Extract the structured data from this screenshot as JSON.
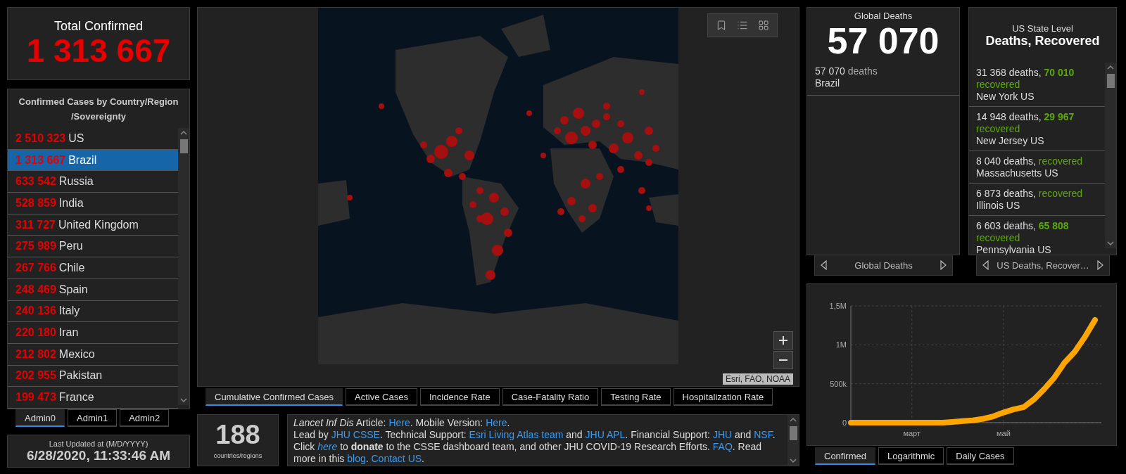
{
  "total_confirmed": {
    "title": "Total Confirmed",
    "value": "1 313 667"
  },
  "country_list": {
    "title_lines": [
      "Confirmed Cases by Country/Region",
      "/Sovereignty"
    ],
    "rows": [
      {
        "count": "2 510 323",
        "name": "US",
        "selected": false
      },
      {
        "count": "1 313 667",
        "name": "Brazil",
        "selected": true
      },
      {
        "count": "633 542",
        "name": "Russia",
        "selected": false
      },
      {
        "count": "528 859",
        "name": "India",
        "selected": false
      },
      {
        "count": "311 727",
        "name": "United Kingdom",
        "selected": false
      },
      {
        "count": "275 989",
        "name": "Peru",
        "selected": false
      },
      {
        "count": "267 766",
        "name": "Chile",
        "selected": false
      },
      {
        "count": "248 469",
        "name": "Spain",
        "selected": false
      },
      {
        "count": "240 136",
        "name": "Italy",
        "selected": false
      },
      {
        "count": "220 180",
        "name": "Iran",
        "selected": false
      },
      {
        "count": "212 802",
        "name": "Mexico",
        "selected": false
      },
      {
        "count": "202 955",
        "name": "Pakistan",
        "selected": false
      },
      {
        "count": "199 473",
        "name": "France",
        "selected": false
      }
    ]
  },
  "admin_tabs": [
    {
      "label": "Admin0",
      "selected": true
    },
    {
      "label": "Admin1",
      "selected": false
    },
    {
      "label": "Admin2",
      "selected": false
    }
  ],
  "last_updated": {
    "label": "Last Updated at (M/D/YYYY)",
    "value": "6/28/2020, 11:33:46 AM"
  },
  "map": {
    "attribution": "Esri, FAO, NOAA"
  },
  "map_tabs": [
    {
      "label": "Cumulative Confirmed Cases",
      "selected": true
    },
    {
      "label": "Active Cases",
      "selected": false
    },
    {
      "label": "Incidence Rate",
      "selected": false
    },
    {
      "label": "Case-Fatality Ratio",
      "selected": false
    },
    {
      "label": "Testing Rate",
      "selected": false
    },
    {
      "label": "Hospitalization Rate",
      "selected": false
    }
  ],
  "country_count": {
    "value": "188",
    "label": "countries/regions"
  },
  "info_paragraphs": [
    [
      {
        "kind": "italic",
        "text": "Lancet Inf Dis"
      },
      {
        "kind": "text",
        "text": " Article: "
      },
      {
        "kind": "link",
        "text": "Here"
      },
      {
        "kind": "text",
        "text": ". Mobile Version: "
      },
      {
        "kind": "link",
        "text": "Here"
      },
      {
        "kind": "text",
        "text": "."
      }
    ],
    [
      {
        "kind": "text",
        "text": "Lead by "
      },
      {
        "kind": "link",
        "text": "JHU CSSE"
      },
      {
        "kind": "text",
        "text": ". Technical Support: "
      },
      {
        "kind": "link",
        "text": "Esri Living Atlas team"
      },
      {
        "kind": "text",
        "text": " and "
      },
      {
        "kind": "link",
        "text": "JHU APL"
      },
      {
        "kind": "text",
        "text": ". Financial Support: "
      },
      {
        "kind": "link",
        "text": "JHU"
      },
      {
        "kind": "text",
        "text": " and "
      },
      {
        "kind": "link",
        "text": "NSF"
      },
      {
        "kind": "text",
        "text": ". Click "
      },
      {
        "kind": "italic-link",
        "text": "here"
      },
      {
        "kind": "text",
        "text": " to "
      },
      {
        "kind": "bold",
        "text": "donate"
      },
      {
        "kind": "text",
        "text": " to the CSSE dashboard team, and other JHU COVID-19 Research Efforts. "
      },
      {
        "kind": "link",
        "text": "FAQ"
      },
      {
        "kind": "text",
        "text": ". Read more in this "
      },
      {
        "kind": "link",
        "text": "blog"
      },
      {
        "kind": "text",
        "text": ". "
      },
      {
        "kind": "link",
        "text": "Contact US"
      },
      {
        "kind": "text",
        "text": "."
      }
    ]
  ],
  "global_deaths": {
    "title": "Global Deaths",
    "value": "57 070",
    "items": [
      {
        "count": "57 070",
        "unit": "deaths",
        "place": "Brazil"
      }
    ],
    "nav_label": "Global Deaths"
  },
  "us_state_level": {
    "subtitle": "US State Level",
    "title": "Deaths, Recovered",
    "rows": [
      {
        "deaths": "31 368 deaths,",
        "recovered_count": "70 010",
        "recovered_label": "recovered",
        "place": "New York US"
      },
      {
        "deaths": "14 948 deaths,",
        "recovered_count": "29 967",
        "recovered_label": "recovered",
        "place": "New Jersey US"
      },
      {
        "deaths": "8 040 deaths,",
        "recovered_label": "recovered",
        "place": "Massachusetts US"
      },
      {
        "deaths": "6 873 deaths,",
        "recovered_label": "recovered",
        "place": "Illinois US"
      },
      {
        "deaths": "6 603 deaths,",
        "recovered_count": "65 808",
        "recovered_label": "recovered",
        "place": "Pennsylvania US"
      }
    ],
    "nav_label": "US Deaths, Recover…"
  },
  "chart": {
    "chart_data": {
      "type": "line",
      "categories": [
        null,
        null,
        null,
        null,
        null,
        null,
        "март",
        null,
        null,
        null,
        null,
        null,
        null,
        null,
        null,
        "май",
        null,
        null,
        null,
        null,
        null,
        null,
        null,
        null,
        null
      ],
      "series": [
        {
          "color": "#ffa500",
          "values": [
            0,
            0,
            0,
            0,
            0,
            0,
            0,
            0,
            0,
            0,
            10000,
            20000,
            30000,
            50000,
            80000,
            130000,
            170000,
            200000,
            300000,
            430000,
            580000,
            770000,
            910000,
            1100000,
            1320000
          ]
        }
      ],
      "grid": true,
      "ylim": [
        0,
        1500000
      ],
      "yticks": [
        {
          "value": 0,
          "label": "0"
        },
        {
          "value": 500000,
          "label": "500k"
        },
        {
          "value": 1000000,
          "label": "1M"
        },
        {
          "value": 1500000,
          "label": "1,5M"
        }
      ]
    }
  },
  "chart_tabs": [
    {
      "label": "Confirmed",
      "selected": true
    },
    {
      "label": "Logarithmic",
      "selected": false
    },
    {
      "label": "Daily Cases",
      "selected": false
    }
  ]
}
